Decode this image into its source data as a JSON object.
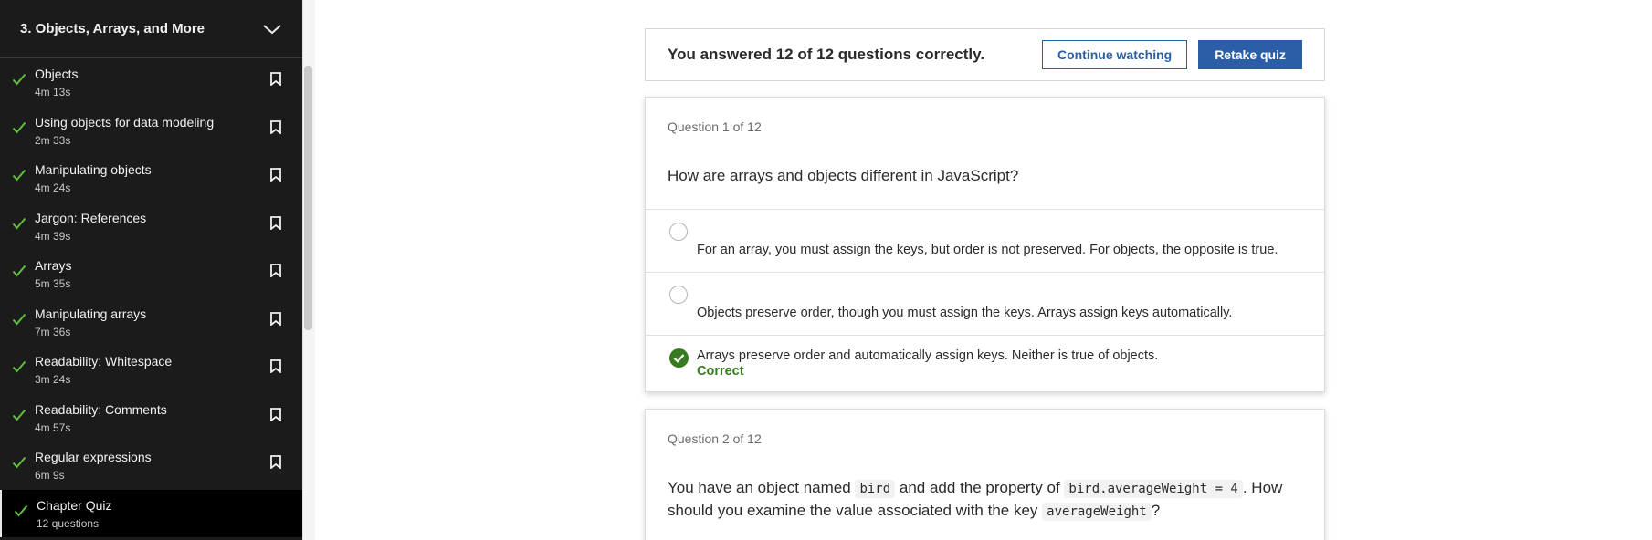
{
  "sidebar": {
    "chapter_title": "3. Objects, Arrays, and More",
    "lessons": [
      {
        "title": "Objects",
        "meta": "4m 13s"
      },
      {
        "title": "Using objects for data modeling",
        "meta": "2m 33s"
      },
      {
        "title": "Manipulating objects",
        "meta": "4m 24s"
      },
      {
        "title": "Jargon: References",
        "meta": "4m 39s"
      },
      {
        "title": "Arrays",
        "meta": "5m 35s"
      },
      {
        "title": "Manipulating arrays",
        "meta": "7m 36s"
      },
      {
        "title": "Readability: Whitespace",
        "meta": "3m 24s"
      },
      {
        "title": "Readability: Comments",
        "meta": "4m 57s"
      },
      {
        "title": "Regular expressions",
        "meta": "6m 9s"
      },
      {
        "title": "Chapter Quiz",
        "meta": "12 questions"
      }
    ]
  },
  "result": {
    "text": "You answered 12 of 12 questions correctly.",
    "continue_label": "Continue watching",
    "retake_label": "Retake quiz"
  },
  "question1": {
    "number": "Question 1 of 12",
    "text": "How are arrays and objects different in JavaScript?",
    "options": [
      "For an array, you must assign the keys, but order is not preserved. For objects, the opposite is true.",
      "Objects preserve order, though you must assign the keys. Arrays assign keys automatically.",
      "Arrays preserve order and automatically assign keys. Neither is true of objects."
    ],
    "correct_label": "Correct"
  },
  "question2": {
    "number": "Question 2 of 12",
    "text_part1": "You have an object named",
    "code1": "bird",
    "text_part2": "and add the property of",
    "code2": "bird.averageWeight = 4",
    "text_part3": ". How",
    "text_part4": "should you examine the value associated with the key",
    "code3": "averageWeight",
    "text_part5": "?"
  },
  "colors": {
    "accent": "#2b5ea6",
    "correct": "#377a1f",
    "sidebar_bg": "#1b1b1b",
    "check": "#5fc039"
  }
}
